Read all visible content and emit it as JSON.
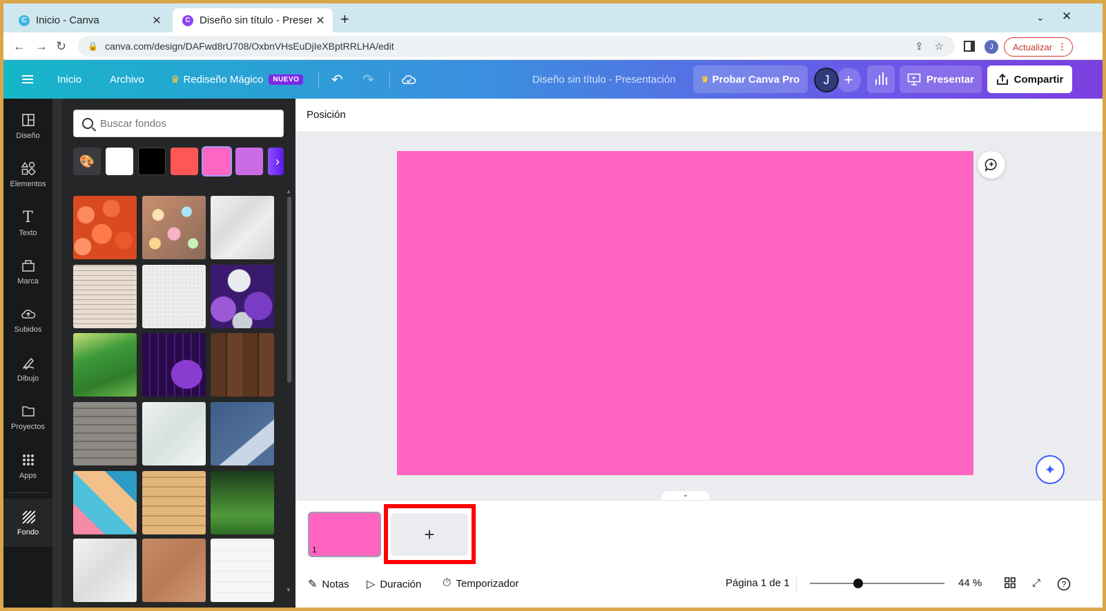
{
  "browser": {
    "tabs": [
      {
        "title": "Inicio - Canva",
        "favicon_color": "#3fb6e0",
        "favicon_letter": "C"
      },
      {
        "title": "Diseño sin título - Present",
        "favicon_color": "#8e44ef",
        "favicon_letter": "C"
      }
    ],
    "url": "canva.com/design/DAFwd8rU708/OxbnVHsEuDjIeXBptRRLHA/edit",
    "profile_letter": "J",
    "update_label": "Actualizar"
  },
  "topbar": {
    "home": "Inicio",
    "file": "Archivo",
    "magic": "Rediseño Mágico",
    "new_badge": "NUEVO",
    "doc_title": "Diseño sin título - Presentación",
    "try_pro": "Probar Canva Pro",
    "avatar_letter": "J",
    "present": "Presentar",
    "share": "Compartir"
  },
  "leftnav": [
    {
      "label": "Diseño",
      "icon": "design-icon"
    },
    {
      "label": "Elementos",
      "icon": "elements-icon"
    },
    {
      "label": "Texto",
      "icon": "text-icon"
    },
    {
      "label": "Marca",
      "icon": "brand-icon"
    },
    {
      "label": "Subidos",
      "icon": "upload-icon"
    },
    {
      "label": "Dibujo",
      "icon": "draw-icon"
    },
    {
      "label": "Proyectos",
      "icon": "folder-icon"
    },
    {
      "label": "Apps",
      "icon": "apps-icon"
    },
    {
      "label": "Fondo",
      "icon": "background-icon"
    }
  ],
  "panel": {
    "search_placeholder": "Buscar fondos",
    "swatches": [
      "#ffffff",
      "#000000",
      "#ff5757",
      "#ff66c4",
      "#cb6ce6"
    ],
    "selected_swatch": "#ff66c4"
  },
  "editor": {
    "context_label": "Posición",
    "slide_color": "#ff64c0",
    "page_number": "1"
  },
  "footer": {
    "notes": "Notas",
    "duration": "Duración",
    "timer": "Temporizador",
    "page_info": "Página 1 de 1",
    "zoom": "44 %",
    "zoom_level": 0.44
  }
}
